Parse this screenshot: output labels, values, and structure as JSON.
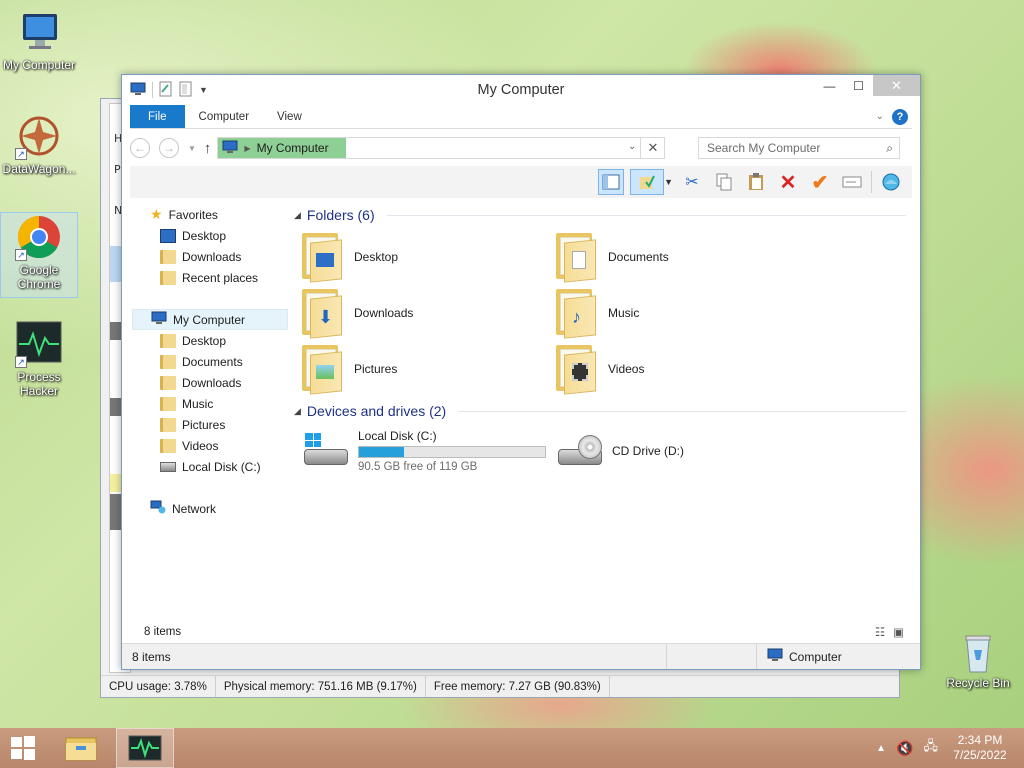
{
  "desktop": {
    "icons": [
      {
        "label": "My Computer",
        "icon": "computer-icon"
      },
      {
        "label": "DataWagon...",
        "icon": "datawagon-icon"
      },
      {
        "label": "Google Chrome",
        "icon": "chrome-icon"
      },
      {
        "label": "Process Hacker",
        "icon": "process-hacker-icon"
      }
    ],
    "recycle_bin": {
      "label": "Recycle Bin",
      "icon": "recycle-bin-icon"
    }
  },
  "process_hacker": {
    "status": {
      "cpu": "CPU usage: 3.78%",
      "physical": "Physical memory: 751.16 MB (9.17%)",
      "free": "Free memory: 7.27 GB (90.83%)"
    },
    "left_strip_chars": [
      "H",
      "P",
      "N"
    ]
  },
  "explorer": {
    "title": "My Computer",
    "tabs": {
      "file": "File",
      "computer": "Computer",
      "view": "View"
    },
    "address": {
      "crumb": "My Computer"
    },
    "search": {
      "placeholder": "Search My Computer"
    },
    "nav": {
      "favorites": "Favorites",
      "fav_items": [
        "Desktop",
        "Downloads",
        "Recent places"
      ],
      "my_computer": "My Computer",
      "pc_items": [
        "Desktop",
        "Documents",
        "Downloads",
        "Music",
        "Pictures",
        "Videos",
        "Local Disk (C:)"
      ],
      "network": "Network"
    },
    "groups": {
      "folders_header": "Folders (6)",
      "folders": [
        "Desktop",
        "Documents",
        "Downloads",
        "Music",
        "Pictures",
        "Videos"
      ],
      "devices_header": "Devices and drives (2)",
      "local_disk": {
        "name": "Local Disk (C:)",
        "free_text": "90.5 GB free of 119 GB",
        "used_fraction": 0.24
      },
      "cd_drive": {
        "name": "CD Drive (D:)"
      }
    },
    "inner_status": "8 items",
    "outer_status": {
      "items": "8 items",
      "location": "Computer"
    }
  },
  "taskbar": {
    "time": "2:34 PM",
    "date": "7/25/2022"
  },
  "colors": {
    "accent": "#1979ca",
    "selection": "#8dcf95",
    "disk_bar": "#26a0da"
  }
}
